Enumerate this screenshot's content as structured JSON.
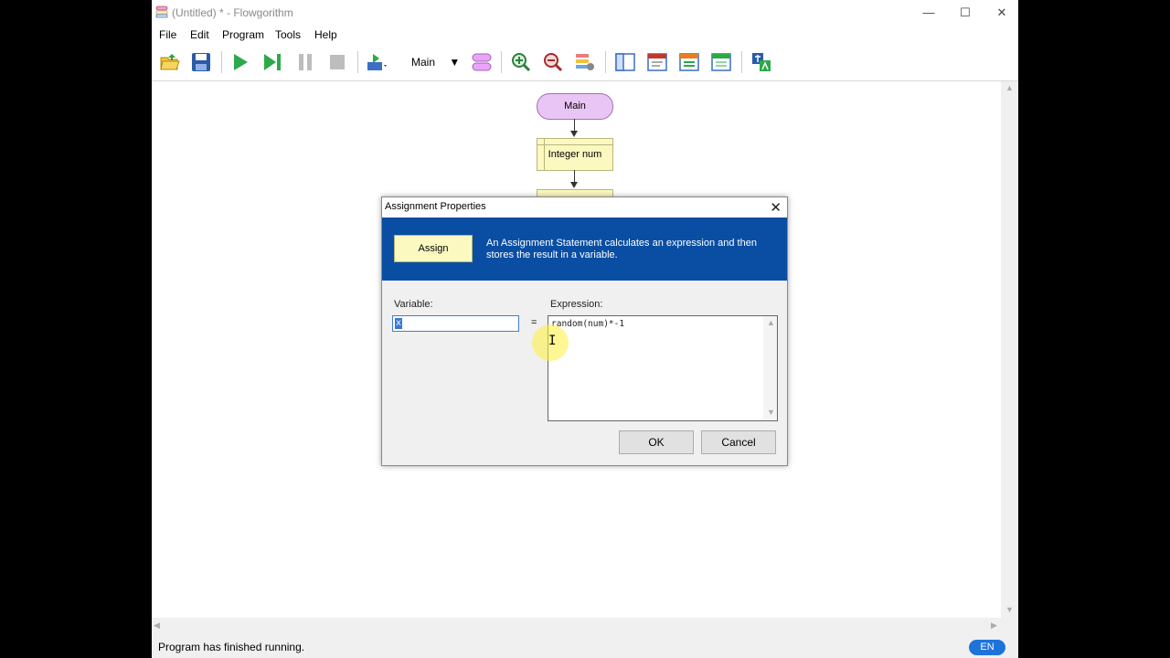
{
  "window": {
    "title": "(Untitled) * - Flowgorithm"
  },
  "menu": [
    "File",
    "Edit",
    "Program",
    "Tools",
    "Help"
  ],
  "toolbar": {
    "function_select": "Main"
  },
  "flowchart": {
    "start_label": "Main",
    "declare_label": "Integer num"
  },
  "dialog": {
    "title": "Assignment Properties",
    "shape_label": "Assign",
    "description": "An Assignment Statement calculates an expression and then stores the result in a variable.",
    "variable_label": "Variable:",
    "variable_value": "x",
    "equals": "=",
    "expression_label": "Expression:",
    "expression_value": "random(num)*-1",
    "ok_label": "OK",
    "cancel_label": "Cancel"
  },
  "status": {
    "text": "Program has finished running.",
    "language": "EN"
  },
  "colors": {
    "banner": "#0a4ea3",
    "accent": "#1e73d9",
    "terminal_fill": "#e9c5f5",
    "process_fill": "#fbf9c0"
  }
}
